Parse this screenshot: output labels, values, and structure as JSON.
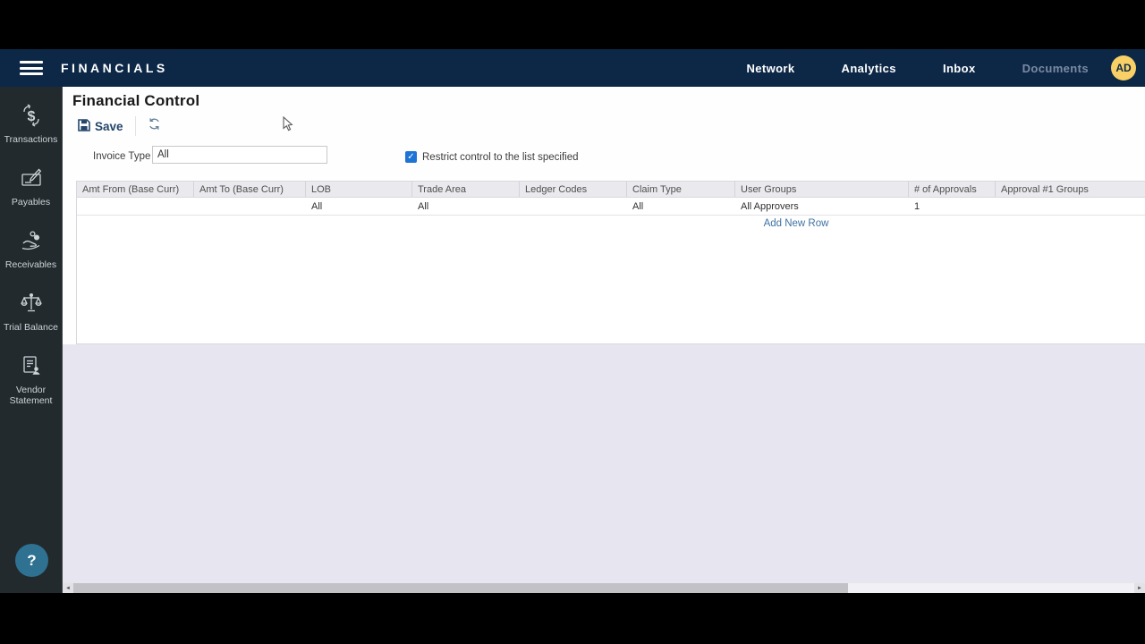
{
  "navbar": {
    "brand": "FINANCIALS",
    "items": [
      {
        "label": "Network",
        "muted": false
      },
      {
        "label": "Analytics",
        "muted": false
      },
      {
        "label": "Inbox",
        "muted": false
      },
      {
        "label": "Documents",
        "muted": true
      }
    ],
    "avatar_initials": "AD"
  },
  "sidebar": {
    "items": [
      {
        "label": "Transactions",
        "icon": "transactions-icon"
      },
      {
        "label": "Payables",
        "icon": "payables-icon"
      },
      {
        "label": "Receivables",
        "icon": "receivables-icon"
      },
      {
        "label": "Trial Balance",
        "icon": "trial-balance-icon"
      },
      {
        "label": "Vendor Statement",
        "icon": "vendor-statement-icon"
      }
    ],
    "help_label": "?"
  },
  "main": {
    "title": "Financial Control",
    "toolbar": {
      "save_label": "Save"
    },
    "form": {
      "invoice_type_label": "Invoice Type",
      "invoice_type_value": "All",
      "restrict_checkbox_label": "Restrict control to the list specified",
      "restrict_checked": true
    },
    "table": {
      "columns": [
        "Amt From (Base Curr)",
        "Amt To (Base Curr)",
        "LOB",
        "Trade Area",
        "Ledger Codes",
        "Claim Type",
        "User Groups",
        "# of Approvals",
        "Approval #1 Groups"
      ],
      "rows": [
        [
          "",
          "",
          "All",
          "All",
          "",
          "All",
          "All Approvers",
          "1",
          ""
        ]
      ],
      "add_row_label": "Add New Row"
    }
  },
  "scrollbar": {
    "left_arrow": "◄",
    "right_arrow": "►"
  },
  "colors": {
    "navbar_bg": "#0d2847",
    "sidebar_bg": "#222a2e",
    "avatar_bg": "#f8d066",
    "help_bg": "#2e7191",
    "link_blue": "#3f73a3",
    "checkbox_blue": "#1d74d4",
    "save_navy": "#24466b",
    "lavender_bg": "#e7e5ef"
  }
}
